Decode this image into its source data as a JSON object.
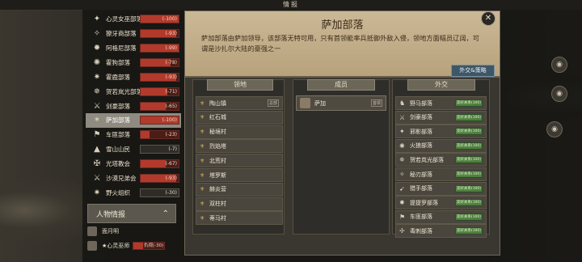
{
  "window_title": "情报",
  "factions": [
    {
      "name": "心灵女巫部落",
      "relation": "(-100)",
      "value": -100,
      "icon": "witch-icon"
    },
    {
      "name": "獠牙商部落",
      "relation": "(-93)",
      "value": -93,
      "icon": "fang-icon"
    },
    {
      "name": "阿格尼部落",
      "relation": "(-99)",
      "value": -99,
      "icon": "tribe-icon"
    },
    {
      "name": "霍狗部落",
      "relation": "(-78)",
      "value": -78,
      "icon": "hound-icon"
    },
    {
      "name": "霍鹿部落",
      "relation": "(-93)",
      "value": -93,
      "icon": "deer-icon"
    },
    {
      "name": "贺若岚光部落",
      "relation": "(-71)",
      "value": -71,
      "icon": "light-icon"
    },
    {
      "name": "剑豪部落",
      "relation": "(-65)",
      "value": -65,
      "icon": "sword-icon"
    },
    {
      "name": "萨加部落",
      "relation": "(-100)",
      "value": -100,
      "icon": "saga-icon",
      "selected": true
    },
    {
      "name": "车匪部落",
      "relation": "(-23)",
      "value": -23,
      "icon": "bandit-icon"
    },
    {
      "name": "雪山山民",
      "relation": "(-7)",
      "value": -7,
      "icon": "mountain-icon",
      "neutral": true
    },
    {
      "name": "光塔教会",
      "relation": "(-67)",
      "value": -67,
      "icon": "church-icon"
    },
    {
      "name": "沙漠兄弟会",
      "relation": "(-93)",
      "value": -93,
      "icon": "desert-icon"
    },
    {
      "name": "野火组织",
      "relation": "(-30)",
      "value": -30,
      "icon": "fire-icon",
      "neutral": true
    }
  ],
  "person_section": {
    "title": "人物情报",
    "people": [
      {
        "name": "面月明",
        "relation": ""
      },
      {
        "name": "★心灵巫师",
        "status": "仇视",
        "relation": "(-30)",
        "value": -30
      }
    ]
  },
  "faction_detail": {
    "name": "萨加部落",
    "description": "萨加部落由萨加领导，该部落无特可用，只有首领能率兵抵御外敌入侵，领地方面幅员辽阔，可谓是沙扎尔大陆的豪强之一",
    "diplomacy_button": "外交&策略"
  },
  "columns": {
    "territory": "领地",
    "members": "成员",
    "diplomacy": "外交"
  },
  "territories": [
    {
      "name": "陶山镇",
      "tag": "总部"
    },
    {
      "name": "红石城"
    },
    {
      "name": "秘境村"
    },
    {
      "name": "烈焰塔"
    },
    {
      "name": "北荒村"
    },
    {
      "name": "塔罗斯"
    },
    {
      "name": "赫炎营"
    },
    {
      "name": "双柱村"
    },
    {
      "name": "蒂马村"
    }
  ],
  "members": [
    {
      "name": "萨加",
      "tag": "首领"
    }
  ],
  "relations": [
    {
      "name": "野马部落",
      "status": "友好关系(100)",
      "icon": "horse-icon"
    },
    {
      "name": "剑豪部落",
      "status": "友好关系(100)",
      "icon": "sword-icon"
    },
    {
      "name": "邪影部落",
      "status": "友好关系(100)",
      "icon": "shadow-icon"
    },
    {
      "name": "火狼部落",
      "status": "友好关系(100)",
      "icon": "wolf-icon"
    },
    {
      "name": "贺若岚光部落",
      "status": "友好关系(100)",
      "icon": "light-icon"
    },
    {
      "name": "秘刃部落",
      "status": "友好关系(100)",
      "icon": "blade-icon"
    },
    {
      "name": "猎手部落",
      "status": "友好关系(100)",
      "icon": "hunter-icon"
    },
    {
      "name": "提提罗部落",
      "status": "友好关系(100)",
      "icon": "tribe-icon"
    },
    {
      "name": "车匪部落",
      "status": "友好关系(100)",
      "icon": "bandit-icon"
    },
    {
      "name": "毒刺部落",
      "status": "友好关系(100)",
      "icon": "sting-icon"
    }
  ],
  "colors": {
    "hostile": "#b23a2c",
    "friendly": "#4d7f3b",
    "header_bg": "#cbb895"
  }
}
